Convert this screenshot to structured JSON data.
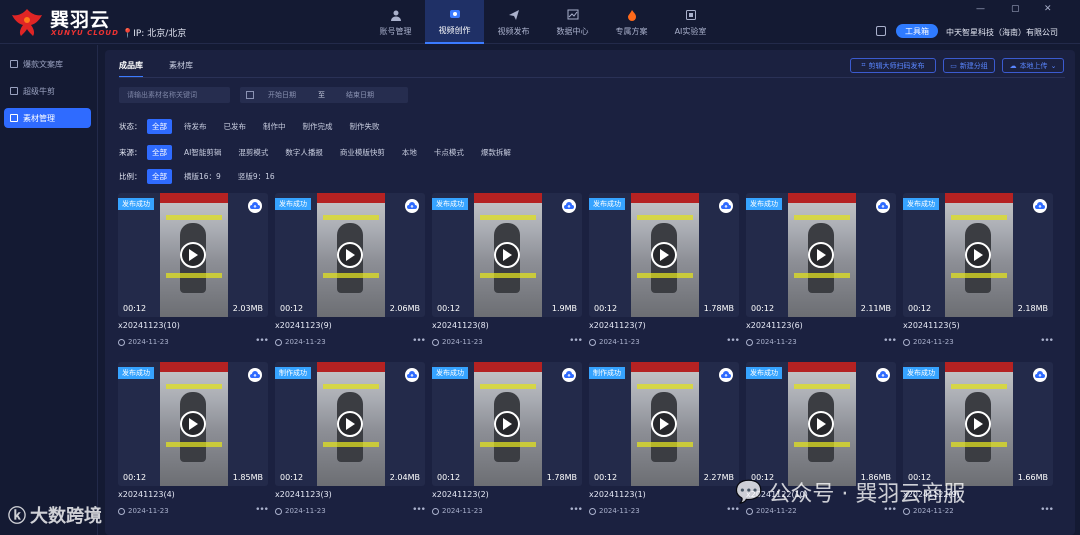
{
  "app": {
    "logo_cn": "巽羽云",
    "logo_en": "XUNYU CLOUD",
    "ip": "IP: 北京/北京",
    "toolbox": "工具箱",
    "company": "中天智星科技（海南）有限公司"
  },
  "nav": [
    {
      "label": "账号管理",
      "icon": "person-icon"
    },
    {
      "label": "视频创作",
      "icon": "video-create-icon",
      "active": true
    },
    {
      "label": "视频发布",
      "icon": "send-icon"
    },
    {
      "label": "数据中心",
      "icon": "chart-icon"
    },
    {
      "label": "专属方案",
      "icon": "flame-icon"
    },
    {
      "label": "AI实验室",
      "icon": "ai-icon"
    }
  ],
  "sidebar": [
    {
      "label": "爆款文案库"
    },
    {
      "label": "超级牛剪"
    },
    {
      "label": "素材管理",
      "active": true
    }
  ],
  "tabs": [
    {
      "label": "成品库",
      "active": true
    },
    {
      "label": "素材库"
    }
  ],
  "actions": {
    "qr": "剪辑大师扫码发布",
    "group": "新建分组",
    "upload": "本地上传"
  },
  "search": {
    "placeholder": "请输出素材名称关键词"
  },
  "date": {
    "start": "开始日期",
    "sep": "至",
    "end": "结束日期"
  },
  "filters": [
    {
      "label": "状态：",
      "options": [
        "全部",
        "待发布",
        "已发布",
        "制作中",
        "制作完成",
        "制作失败"
      ],
      "active": 0
    },
    {
      "label": "来源：",
      "options": [
        "全部",
        "AI智能剪辑",
        "混剪模式",
        "数字人播报",
        "商业模版快剪",
        "本地",
        "卡点模式",
        "爆款拆解"
      ],
      "active": 0
    },
    {
      "label": "比例：",
      "options": [
        "全部",
        "横版16：9",
        "竖版9：16"
      ],
      "active": 0
    }
  ],
  "cards": [
    {
      "badge": "发布成功",
      "duration": "00:12",
      "size": "2.03MB",
      "title": "x20241123(10)",
      "date": "2024-11-23"
    },
    {
      "badge": "发布成功",
      "duration": "00:12",
      "size": "2.06MB",
      "title": "x20241123(9)",
      "date": "2024-11-23"
    },
    {
      "badge": "发布成功",
      "duration": "00:12",
      "size": "1.9MB",
      "title": "x20241123(8)",
      "date": "2024-11-23"
    },
    {
      "badge": "发布成功",
      "duration": "00:12",
      "size": "1.78MB",
      "title": "x20241123(7)",
      "date": "2024-11-23"
    },
    {
      "badge": "发布成功",
      "duration": "00:12",
      "size": "2.11MB",
      "title": "x20241123(6)",
      "date": "2024-11-23"
    },
    {
      "badge": "发布成功",
      "duration": "00:12",
      "size": "2.18MB",
      "title": "x20241123(5)",
      "date": "2024-11-23"
    },
    {
      "badge": "发布成功",
      "duration": "00:12",
      "size": "1.85MB",
      "title": "x20241123(4)",
      "date": "2024-11-23"
    },
    {
      "badge": "制作成功",
      "duration": "00:12",
      "size": "2.04MB",
      "title": "x20241123(3)",
      "date": "2024-11-23"
    },
    {
      "badge": "发布成功",
      "duration": "00:12",
      "size": "1.78MB",
      "title": "x20241123(2)",
      "date": "2024-11-23"
    },
    {
      "badge": "制作成功",
      "duration": "00:12",
      "size": "2.27MB",
      "title": "x20241123(1)",
      "date": "2024-11-23"
    },
    {
      "badge": "发布成功",
      "duration": "00:12",
      "size": "1.86MB",
      "title": "x20241122(10)",
      "date": "2024-11-22"
    },
    {
      "badge": "发布成功",
      "duration": "00:12",
      "size": "1.66MB",
      "title": "x20241122(9)",
      "date": "2024-11-22"
    }
  ],
  "watermarks": {
    "wechat": "公众号 · 巽羽云商服",
    "brand": "大数跨境"
  },
  "colors": {
    "accent": "#2f6bff",
    "badge": "#36a3ff",
    "bg": "#141a33",
    "panel": "#1b2140"
  }
}
